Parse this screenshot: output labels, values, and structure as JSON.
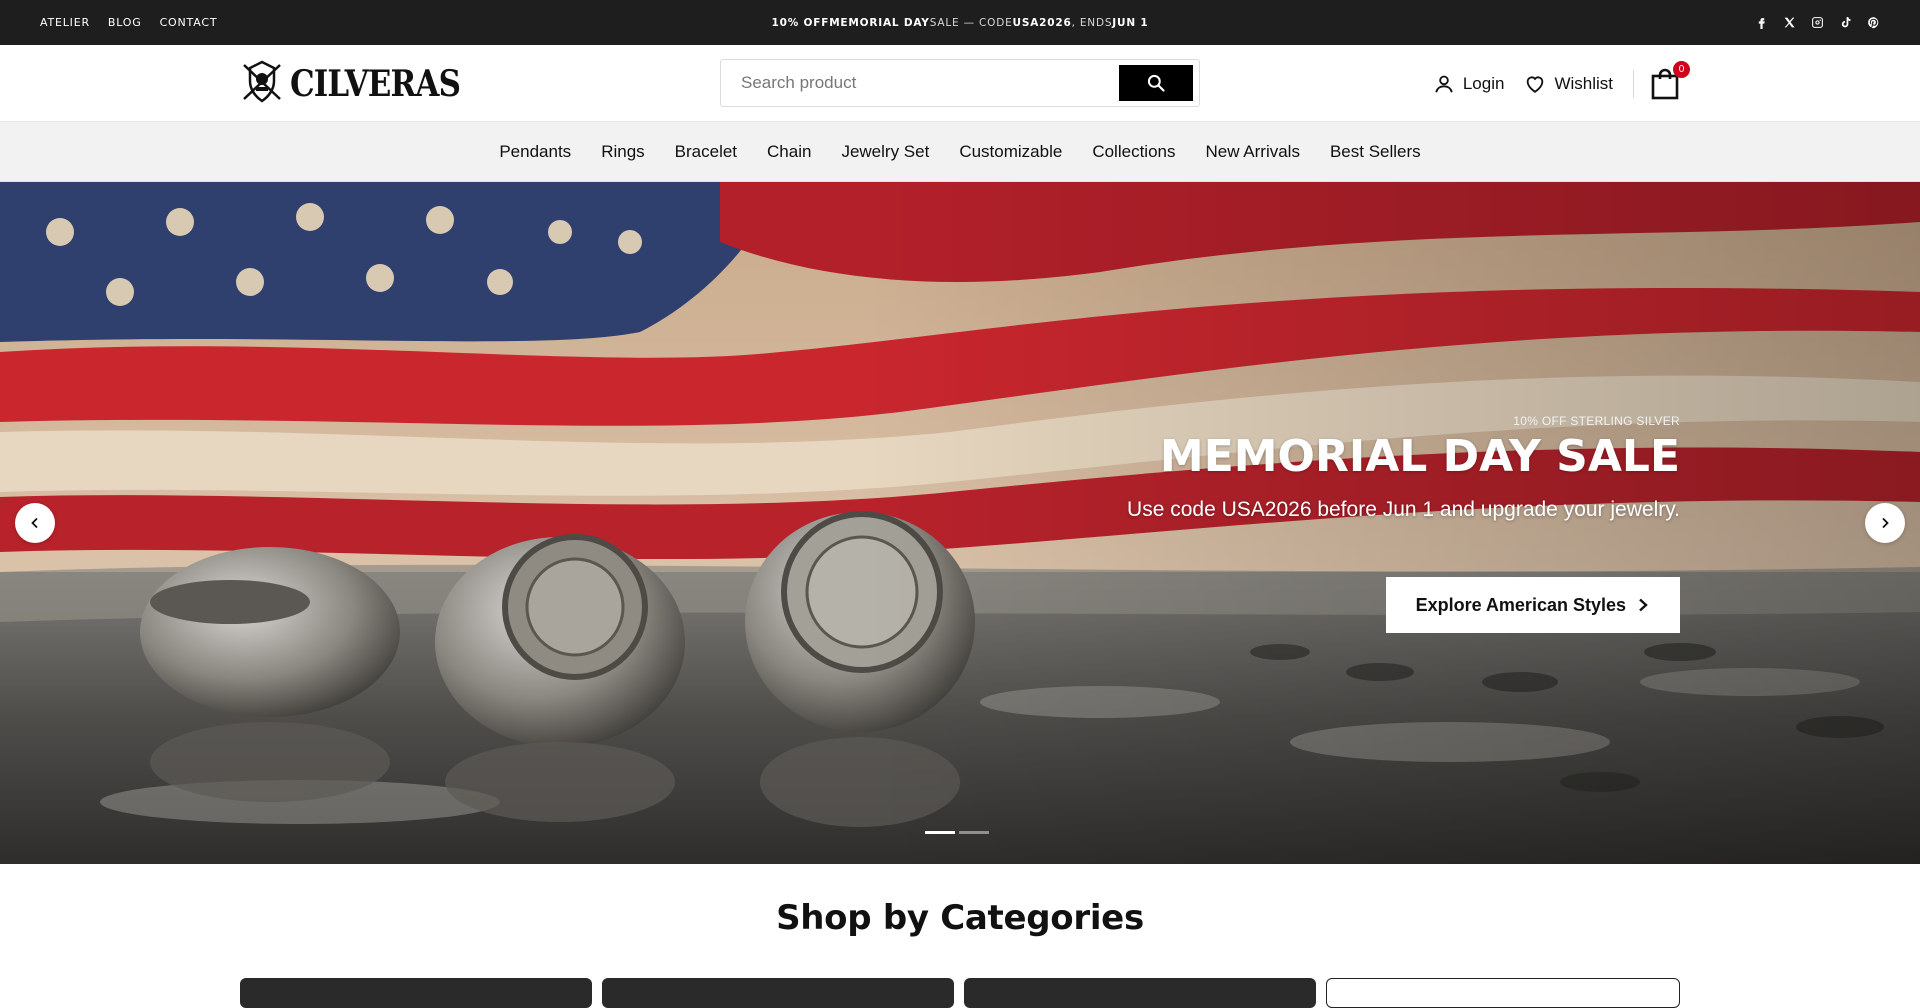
{
  "topbar": {
    "links": [
      "ATELIER",
      "BLOG",
      "CONTACT"
    ],
    "announcement": {
      "part1": "10% OFF ",
      "part2": "MEMORIAL DAY",
      "part3": " SALE — CODE ",
      "part4": "USA2026",
      "part5": ", ENDS ",
      "part6": "JUN 1"
    },
    "social_icons": [
      "facebook-icon",
      "x-icon",
      "instagram-icon",
      "tiktok-icon",
      "pinterest-icon"
    ]
  },
  "header": {
    "logo_text": "CILVERAS",
    "search_placeholder": "Search product",
    "login_label": "Login",
    "wishlist_label": "Wishlist",
    "cart_count": "0"
  },
  "nav": {
    "items": [
      "Pendants",
      "Rings",
      "Bracelet",
      "Chain",
      "Jewelry Set",
      "Customizable",
      "Collections",
      "New Arrivals",
      "Best Sellers"
    ]
  },
  "hero": {
    "eyebrow": "10% OFF STERLING SILVER",
    "title": "MEMORIAL DAY SALE",
    "subtitle": "Use code USA2026 before Jun 1 and upgrade your jewelry.",
    "cta_label": "Explore American Styles",
    "slide_count": 2,
    "active_slide": 1
  },
  "categories": {
    "title": "Shop by Categories"
  },
  "colors": {
    "topbar_bg": "#1e1e1e",
    "nav_bg": "#f2f2f2",
    "badge": "#d0021b",
    "search_button": "#000000"
  }
}
